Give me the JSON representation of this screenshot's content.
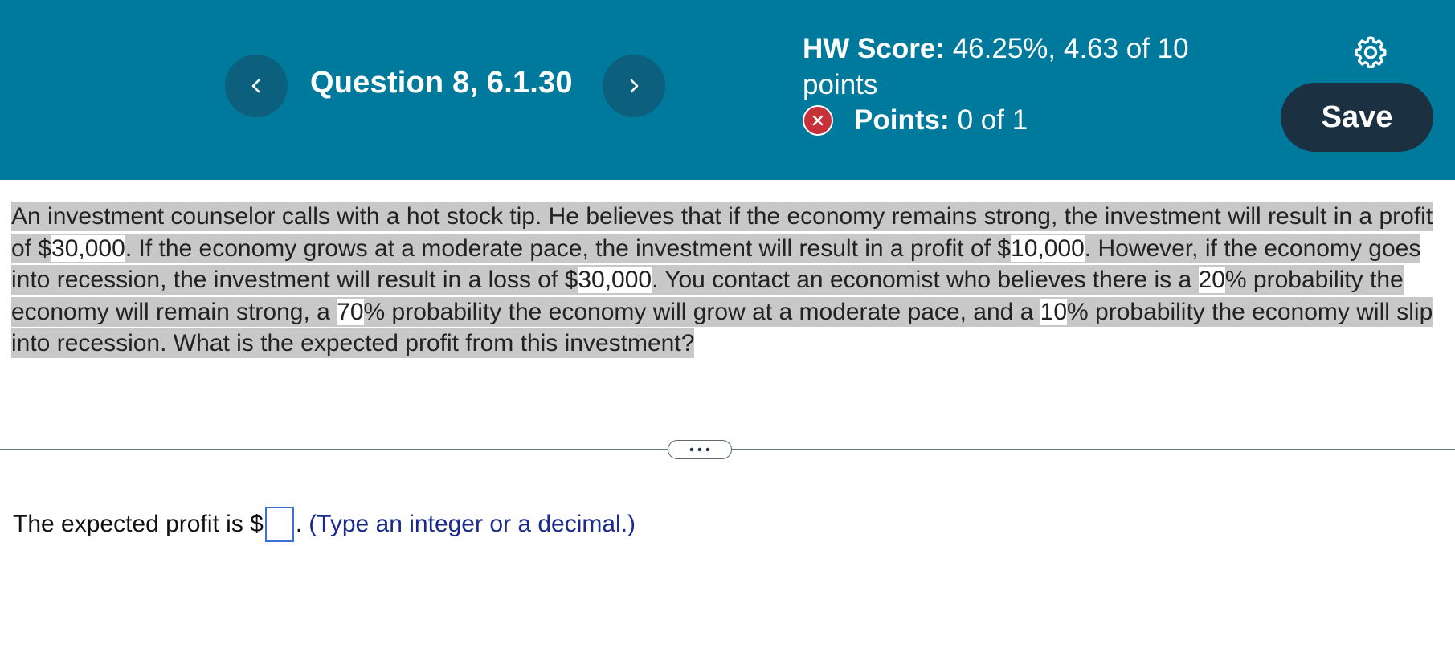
{
  "header": {
    "prev_icon": "chevron-left-icon",
    "next_icon": "chevron-right-icon",
    "question_title": "Question 8, 6.1.30",
    "hw_score_label": "HW Score:",
    "hw_score_value": "46.25%, 4.63 of 10",
    "hw_score_value_cont": "points",
    "points_status_icon": "x-circle-icon",
    "points_label": "Points:",
    "points_value": "0 of 1",
    "settings_icon": "gear-icon",
    "save_label": "Save"
  },
  "problem": {
    "t1": "An investment counselor calls with a hot stock tip. He believes that if the economy remains strong, the investment will result in a profit of $",
    "n1": "30,000",
    "t2": ". If the economy grows at a moderate pace, the investment will result in a profit of $",
    "n2": "10,000",
    "t3": ". However, if the economy goes into recession, the investment will result in a loss of $",
    "n3": "30,000",
    "t4": ". You contact an economist who believes there is a ",
    "n4": "20",
    "t5": "% probability the economy will remain strong, a ",
    "n5": "70",
    "t6": "% probability the economy will grow at a moderate pace, and a ",
    "n6": "10",
    "t7": "% probability the economy will slip into recession. What is the expected profit from this investment?"
  },
  "divider": {
    "more_icon": "ellipsis-icon"
  },
  "answer": {
    "prefix": "The expected profit is $",
    "input_value": "",
    "suffix": ".",
    "hint": "(Type an integer or a decimal.)"
  },
  "colors": {
    "header_bg": "#007a9c",
    "nav_button_bg": "#0d5f7e",
    "save_button_bg": "#1b3142",
    "incorrect_badge": "#c8313a",
    "highlight": "#c8c8c8",
    "hint_text": "#1a2a8c",
    "input_border": "#3a6fd6"
  }
}
